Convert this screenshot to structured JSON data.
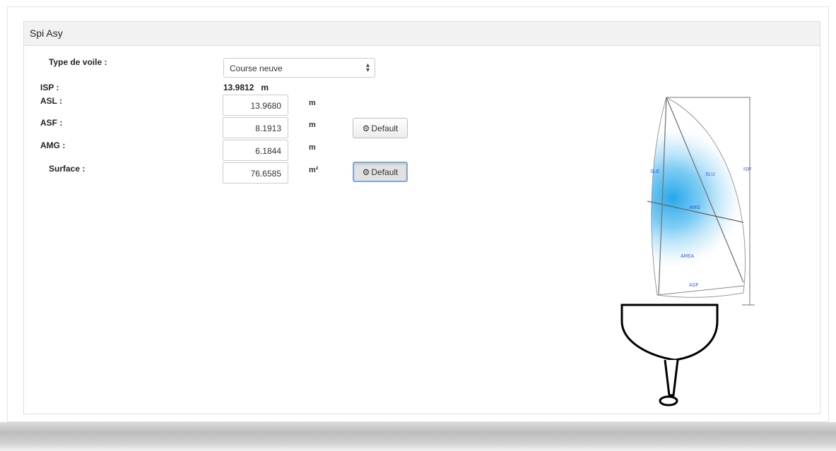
{
  "panel": {
    "title": "Spi Asy"
  },
  "form": {
    "type_label": "Type de voile :",
    "type_value": "Course neuve",
    "isp_label": "ISP :",
    "isp_value": "13.9812",
    "isp_unit": "m",
    "asl_label": "ASL :",
    "asl_value": "13.9680",
    "asl_unit": "m",
    "asf_label": "ASF :",
    "asf_value": "8.1913",
    "asf_unit": "m",
    "amg_label": "AMG :",
    "amg_value": "6.1844",
    "amg_unit": "m",
    "surface_label": "Surface :",
    "surface_value": "76.6585",
    "surface_unit": "m²",
    "default_label": "Default",
    "default_icon": "gear-icon"
  },
  "diagram": {
    "sle": "SLE",
    "slu": "SLU",
    "isp": "ISP",
    "amg": "AMG",
    "area": "AREA",
    "asf": "ASF",
    "label_color": "#3a5bd6",
    "fill_color": "#1aa3e8"
  }
}
